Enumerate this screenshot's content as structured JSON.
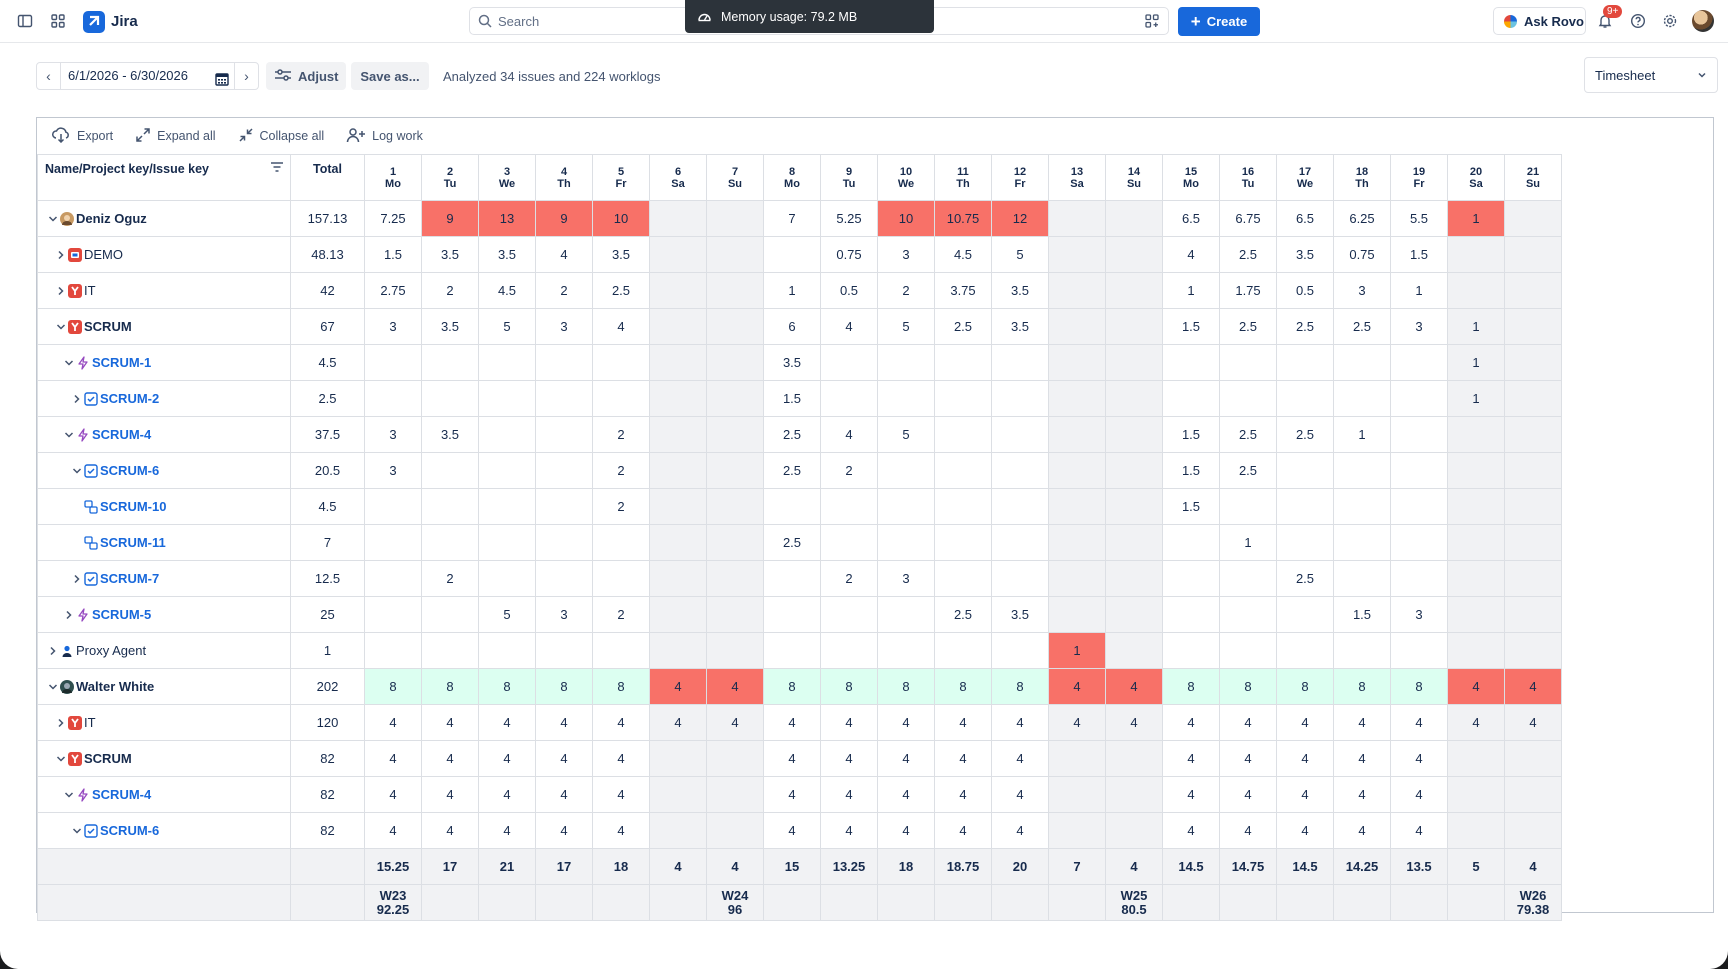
{
  "header": {
    "app_name": "Jira",
    "search_placeholder": "Search",
    "create_label": "Create",
    "memory_label": "Memory usage: 79.2 MB",
    "ask_rovo_label": "Ask Rovo",
    "notifications_badge": "9+"
  },
  "toolbar": {
    "date_range": "6/1/2026 - 6/30/2026",
    "adjust_label": "Adjust",
    "save_as_label": "Save as...",
    "analyzed_text": "Analyzed 34 issues and 224 worklogs",
    "view_select": "Timesheet"
  },
  "grid_actions": {
    "export": "Export",
    "expand_all": "Expand all",
    "collapse_all": "Collapse all",
    "log_work": "Log work"
  },
  "columns": {
    "name_header": "Name/Project key/Issue key",
    "total_header": "Total",
    "days": [
      {
        "d": "1",
        "w": "Mo",
        "weekend": false
      },
      {
        "d": "2",
        "w": "Tu",
        "weekend": false
      },
      {
        "d": "3",
        "w": "We",
        "weekend": false
      },
      {
        "d": "4",
        "w": "Th",
        "weekend": false
      },
      {
        "d": "5",
        "w": "Fr",
        "weekend": false
      },
      {
        "d": "6",
        "w": "Sa",
        "weekend": true
      },
      {
        "d": "7",
        "w": "Su",
        "weekend": true
      },
      {
        "d": "8",
        "w": "Mo",
        "weekend": false
      },
      {
        "d": "9",
        "w": "Tu",
        "weekend": false
      },
      {
        "d": "10",
        "w": "We",
        "weekend": false
      },
      {
        "d": "11",
        "w": "Th",
        "weekend": false
      },
      {
        "d": "12",
        "w": "Fr",
        "weekend": false
      },
      {
        "d": "13",
        "w": "Sa",
        "weekend": true
      },
      {
        "d": "14",
        "w": "Su",
        "weekend": true
      },
      {
        "d": "15",
        "w": "Mo",
        "weekend": false
      },
      {
        "d": "16",
        "w": "Tu",
        "weekend": false
      },
      {
        "d": "17",
        "w": "We",
        "weekend": false
      },
      {
        "d": "18",
        "w": "Th",
        "weekend": false
      },
      {
        "d": "19",
        "w": "Fr",
        "weekend": false
      },
      {
        "d": "20",
        "w": "Sa",
        "weekend": true
      },
      {
        "d": "21",
        "w": "Su",
        "weekend": true
      }
    ]
  },
  "rows": [
    {
      "name": "Deniz Oguz",
      "level": 0,
      "chev": "down",
      "icon": "user-avatar",
      "style": "bold",
      "total": "157.13",
      "cells": [
        "7.25",
        "9",
        "13",
        "9",
        "10",
        "",
        "",
        "7",
        "5.25",
        "10",
        "10.75",
        "12",
        "",
        "",
        "6.5",
        "6.75",
        "6.5",
        "6.25",
        "5.5",
        "1",
        ""
      ],
      "hl": [
        "",
        "red",
        "red",
        "red",
        "red",
        "",
        "",
        "",
        "",
        "red",
        "red",
        "red",
        "",
        "",
        "",
        "",
        "",
        "",
        "",
        "red",
        ""
      ]
    },
    {
      "name": "DEMO",
      "level": 1,
      "chev": "right",
      "icon": "demo-project",
      "style": "plain",
      "total": "48.13",
      "cells": [
        "1.5",
        "3.5",
        "3.5",
        "4",
        "3.5",
        "",
        "",
        "",
        "0.75",
        "3",
        "4.5",
        "5",
        "",
        "",
        "4",
        "2.5",
        "3.5",
        "0.75",
        "1.5",
        "",
        ""
      ]
    },
    {
      "name": "IT",
      "level": 1,
      "chev": "right",
      "icon": "project",
      "style": "plain",
      "total": "42",
      "cells": [
        "2.75",
        "2",
        "4.5",
        "2",
        "2.5",
        "",
        "",
        "1",
        "0.5",
        "2",
        "3.75",
        "3.5",
        "",
        "",
        "1",
        "1.75",
        "0.5",
        "3",
        "1",
        "",
        ""
      ]
    },
    {
      "name": "SCRUM",
      "level": 1,
      "chev": "down",
      "icon": "project",
      "style": "bold",
      "total": "67",
      "cells": [
        "3",
        "3.5",
        "5",
        "3",
        "4",
        "",
        "",
        "6",
        "4",
        "5",
        "2.5",
        "3.5",
        "",
        "",
        "1.5",
        "2.5",
        "2.5",
        "2.5",
        "3",
        "1",
        ""
      ]
    },
    {
      "name": "SCRUM-1",
      "level": 2,
      "chev": "down",
      "icon": "epic",
      "style": "link",
      "total": "4.5",
      "cells": [
        "",
        "",
        "",
        "",
        "",
        "",
        "",
        "3.5",
        "",
        "",
        "",
        "",
        "",
        "",
        "",
        "",
        "",
        "",
        "",
        "1",
        ""
      ]
    },
    {
      "name": "SCRUM-2",
      "level": 3,
      "chev": "right",
      "icon": "task",
      "style": "link",
      "total": "2.5",
      "cells": [
        "",
        "",
        "",
        "",
        "",
        "",
        "",
        "1.5",
        "",
        "",
        "",
        "",
        "",
        "",
        "",
        "",
        "",
        "",
        "",
        "1",
        ""
      ]
    },
    {
      "name": "SCRUM-4",
      "level": 2,
      "chev": "down",
      "icon": "epic",
      "style": "link",
      "total": "37.5",
      "cells": [
        "3",
        "3.5",
        "",
        "",
        "2",
        "",
        "",
        "2.5",
        "4",
        "5",
        "",
        "",
        "",
        "",
        "1.5",
        "2.5",
        "2.5",
        "1",
        "",
        "",
        ""
      ]
    },
    {
      "name": "SCRUM-6",
      "level": 3,
      "chev": "down",
      "icon": "task",
      "style": "link",
      "total": "20.5",
      "cells": [
        "3",
        "",
        "",
        "",
        "2",
        "",
        "",
        "2.5",
        "2",
        "",
        "",
        "",
        "",
        "",
        "1.5",
        "2.5",
        "",
        "",
        "",
        "",
        ""
      ]
    },
    {
      "name": "SCRUM-10",
      "level": 4,
      "chev": "",
      "icon": "subtask",
      "style": "link",
      "total": "4.5",
      "cells": [
        "",
        "",
        "",
        "",
        "2",
        "",
        "",
        "",
        "",
        "",
        "",
        "",
        "",
        "",
        "1.5",
        "",
        "",
        "",
        "",
        "",
        ""
      ]
    },
    {
      "name": "SCRUM-11",
      "level": 4,
      "chev": "",
      "icon": "subtask",
      "style": "link",
      "total": "7",
      "cells": [
        "",
        "",
        "",
        "",
        "",
        "",
        "",
        "2.5",
        "",
        "",
        "",
        "",
        "",
        "",
        "",
        "1",
        "",
        "",
        "",
        "",
        ""
      ]
    },
    {
      "name": "SCRUM-7",
      "level": 3,
      "chev": "right",
      "icon": "task",
      "style": "link",
      "total": "12.5",
      "cells": [
        "",
        "2",
        "",
        "",
        "",
        "",
        "",
        "",
        "2",
        "3",
        "",
        "",
        "",
        "",
        "",
        "",
        "2.5",
        "",
        "",
        "",
        ""
      ]
    },
    {
      "name": "SCRUM-5",
      "level": 2,
      "chev": "right",
      "icon": "epic",
      "style": "link",
      "total": "25",
      "cells": [
        "",
        "",
        "5",
        "3",
        "2",
        "",
        "",
        "",
        "",
        "",
        "2.5",
        "3.5",
        "",
        "",
        "",
        "",
        "",
        "1.5",
        "3",
        "",
        ""
      ]
    },
    {
      "name": "Proxy Agent",
      "level": 0,
      "chev": "right",
      "icon": "person",
      "style": "plain",
      "total": "1",
      "cells": [
        "",
        "",
        "",
        "",
        "",
        "",
        "",
        "",
        "",
        "",
        "",
        "",
        "1",
        "",
        "",
        "",
        "",
        "",
        "",
        "",
        ""
      ],
      "hl": [
        "",
        "",
        "",
        "",
        "",
        "",
        "",
        "",
        "",
        "",
        "",
        "",
        "red",
        "",
        "",
        "",
        "",
        "",
        "",
        "",
        ""
      ]
    },
    {
      "name": "Walter White",
      "level": 0,
      "chev": "down",
      "icon": "user-avatar-2",
      "style": "bold",
      "total": "202",
      "cells": [
        "8",
        "8",
        "8",
        "8",
        "8",
        "4",
        "4",
        "8",
        "8",
        "8",
        "8",
        "8",
        "4",
        "4",
        "8",
        "8",
        "8",
        "8",
        "8",
        "4",
        "4"
      ],
      "hl": [
        "green",
        "green",
        "green",
        "green",
        "green",
        "red",
        "red",
        "green",
        "green",
        "green",
        "green",
        "green",
        "red",
        "red",
        "green",
        "green",
        "green",
        "green",
        "green",
        "red",
        "red"
      ]
    },
    {
      "name": "IT",
      "level": 1,
      "chev": "right",
      "icon": "project",
      "style": "plain",
      "total": "120",
      "cells": [
        "4",
        "4",
        "4",
        "4",
        "4",
        "4",
        "4",
        "4",
        "4",
        "4",
        "4",
        "4",
        "4",
        "4",
        "4",
        "4",
        "4",
        "4",
        "4",
        "4",
        "4"
      ]
    },
    {
      "name": "SCRUM",
      "level": 1,
      "chev": "down",
      "icon": "project",
      "style": "bold",
      "total": "82",
      "cells": [
        "4",
        "4",
        "4",
        "4",
        "4",
        "",
        "",
        "4",
        "4",
        "4",
        "4",
        "4",
        "",
        "",
        "4",
        "4",
        "4",
        "4",
        "4",
        "",
        ""
      ]
    },
    {
      "name": "SCRUM-4",
      "level": 2,
      "chev": "down",
      "icon": "epic",
      "style": "link",
      "total": "82",
      "cells": [
        "4",
        "4",
        "4",
        "4",
        "4",
        "",
        "",
        "4",
        "4",
        "4",
        "4",
        "4",
        "",
        "",
        "4",
        "4",
        "4",
        "4",
        "4",
        "",
        ""
      ]
    },
    {
      "name": "SCRUM-6",
      "level": 3,
      "chev": "down",
      "icon": "task",
      "style": "link",
      "total": "82",
      "cells": [
        "4",
        "4",
        "4",
        "4",
        "4",
        "",
        "",
        "4",
        "4",
        "4",
        "4",
        "4",
        "",
        "",
        "4",
        "4",
        "4",
        "4",
        "4",
        "",
        ""
      ]
    }
  ],
  "day_totals": [
    "15.25",
    "17",
    "21",
    "17",
    "18",
    "4",
    "4",
    "15",
    "13.25",
    "18",
    "18.75",
    "20",
    "7",
    "4",
    "14.5",
    "14.75",
    "14.5",
    "14.25",
    "13.5",
    "5",
    "4"
  ],
  "weeks": [
    {
      "label": "W23",
      "total": "92.25"
    },
    {
      "label": "W24",
      "total": "96"
    },
    {
      "label": "W25",
      "total": "80.5"
    },
    {
      "label": "W26",
      "total": "79.38"
    }
  ],
  "colors": {
    "accent": "#1868db",
    "over": "#f87168",
    "ok": "#dcfff1",
    "weekend": "#f1f2f4"
  }
}
